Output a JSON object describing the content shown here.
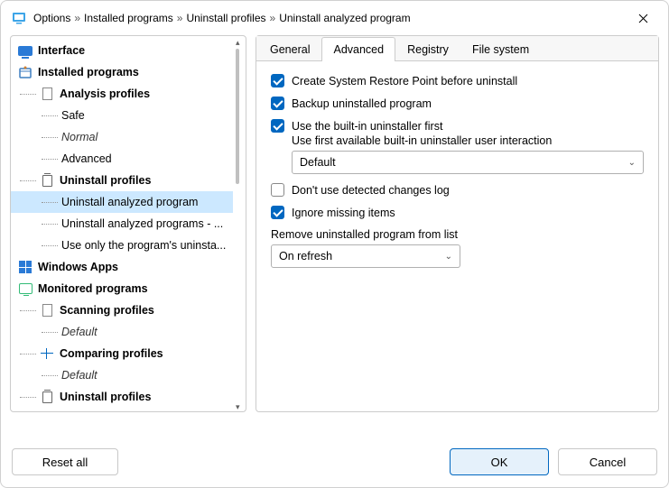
{
  "breadcrumb": [
    "Options",
    "Installed programs",
    "Uninstall profiles",
    "Uninstall analyzed program"
  ],
  "tree": [
    {
      "label": "Interface",
      "lvl": 0,
      "bold": true,
      "icon": "monitor"
    },
    {
      "label": "Installed programs",
      "lvl": 0,
      "bold": true,
      "icon": "box"
    },
    {
      "label": "Analysis profiles",
      "lvl": 1,
      "bold": true,
      "icon": "doc"
    },
    {
      "label": "Safe",
      "lvl": 2
    },
    {
      "label": "Normal",
      "lvl": 2,
      "italic": true
    },
    {
      "label": "Advanced",
      "lvl": 2
    },
    {
      "label": "Uninstall profiles",
      "lvl": 1,
      "bold": true,
      "icon": "trash"
    },
    {
      "label": "Uninstall analyzed program",
      "lvl": 2,
      "selected": true
    },
    {
      "label": "Uninstall analyzed programs - ...",
      "lvl": 2
    },
    {
      "label": "Use only the program's uninsta...",
      "lvl": 2
    },
    {
      "label": "Windows Apps",
      "lvl": 0,
      "bold": true,
      "icon": "grid"
    },
    {
      "label": "Monitored programs",
      "lvl": 0,
      "bold": true,
      "icon": "mon2"
    },
    {
      "label": "Scanning profiles",
      "lvl": 1,
      "bold": true,
      "icon": "doc"
    },
    {
      "label": "Default",
      "lvl": 2,
      "italic": true
    },
    {
      "label": "Comparing profiles",
      "lvl": 1,
      "bold": true,
      "icon": "scale"
    },
    {
      "label": "Default",
      "lvl": 2,
      "italic": true
    },
    {
      "label": "Uninstall profiles",
      "lvl": 1,
      "bold": true,
      "icon": "trash"
    }
  ],
  "tabs": [
    "General",
    "Advanced",
    "Registry",
    "File system"
  ],
  "active_tab": 1,
  "options": {
    "create_restore": {
      "label": "Create System Restore Point before uninstall",
      "checked": true
    },
    "backup": {
      "label": "Backup uninstalled program",
      "checked": true
    },
    "builtin": {
      "label": "Use the built-in uninstaller first",
      "checked": true,
      "sub_label": "Use first available built-in uninstaller user interaction",
      "sub_value": "Default"
    },
    "dont_use_log": {
      "label": "Don't use detected changes log",
      "checked": false
    },
    "ignore_missing": {
      "label": "Ignore missing items",
      "checked": true
    },
    "remove_list": {
      "label": "Remove uninstalled program from list",
      "value": "On refresh"
    }
  },
  "buttons": {
    "reset": "Reset all",
    "ok": "OK",
    "cancel": "Cancel"
  }
}
